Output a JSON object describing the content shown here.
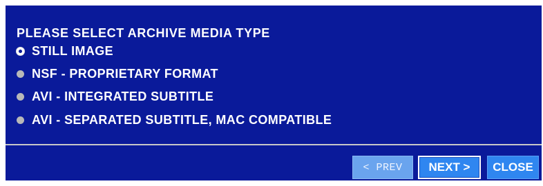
{
  "dialog": {
    "heading": "PLEASE SELECT ARCHIVE MEDIA TYPE",
    "options": [
      {
        "label": "STILL IMAGE",
        "selected": true
      },
      {
        "label": "NSF - PROPRIETARY FORMAT",
        "selected": false
      },
      {
        "label": "AVI - INTEGRATED SUBTITLE",
        "selected": false
      },
      {
        "label": "AVI - SEPARATED SUBTITLE, MAC COMPATIBLE",
        "selected": false
      }
    ],
    "buttons": {
      "prev_label": "< PREV",
      "next_label": "NEXT >",
      "close_label": "CLOSE"
    }
  },
  "colors": {
    "dialog_background": "#0a1a9a",
    "button_background": "#2f86f0",
    "disabled_button_background": "#6aa4ee",
    "text": "#ffffff"
  }
}
